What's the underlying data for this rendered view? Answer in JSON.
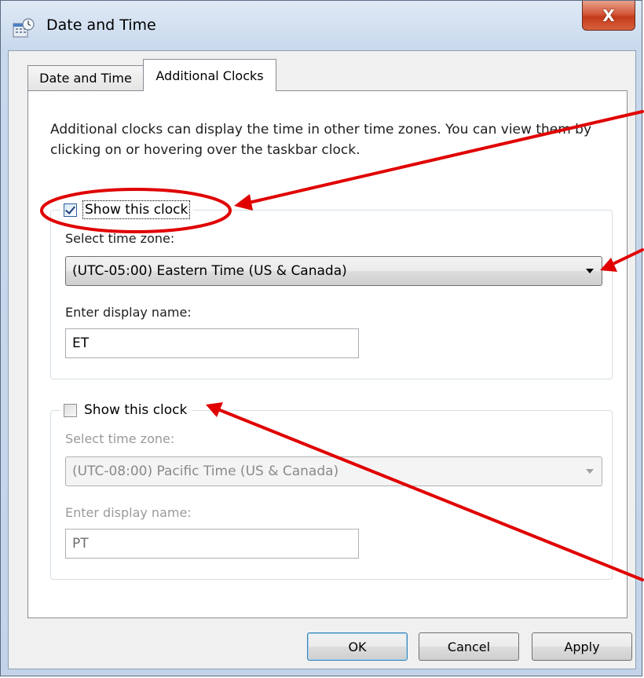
{
  "window": {
    "title": "Date and Time",
    "close_glyph": "X",
    "accent_close": "#c43b1a"
  },
  "tabs": [
    {
      "label": "Date and Time",
      "selected": false
    },
    {
      "label": "Additional Clocks",
      "selected": true
    }
  ],
  "intro_text": "Additional clocks can display the time in other time zones. You can view them by clicking on or hovering over the taskbar clock.",
  "clocks": [
    {
      "show_label": "Show this clock",
      "checked": true,
      "timezone_label": "Select time zone:",
      "timezone_value": "(UTC-05:00) Eastern Time (US & Canada)",
      "display_name_label": "Enter display name:",
      "display_name_value": "ET",
      "enabled": true
    },
    {
      "show_label": "Show this clock",
      "checked": false,
      "timezone_label": "Select time zone:",
      "timezone_value": "(UTC-08:00) Pacific Time (US & Canada)",
      "display_name_label": "Enter display name:",
      "display_name_value": "PT",
      "enabled": false
    }
  ],
  "buttons": {
    "ok": "OK",
    "cancel": "Cancel",
    "apply": "Apply"
  },
  "annotation_color": "#e00000",
  "icons": {
    "app": "date-time-control-panel-icon",
    "close": "close-icon",
    "dropdown": "chevron-down-icon"
  }
}
